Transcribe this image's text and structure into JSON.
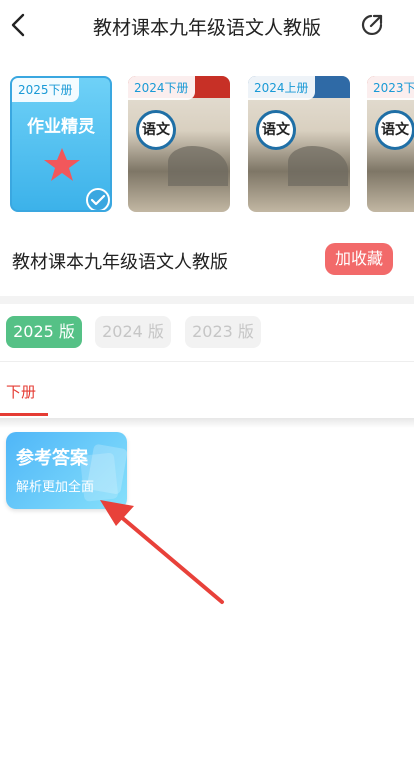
{
  "header": {
    "title": "教材课本九年级语文人教版",
    "back_icon": "chevron-left-icon",
    "share_icon": "share-icon"
  },
  "books": [
    {
      "tag": "2025下册",
      "cover_text": "作业精灵",
      "selected": true
    },
    {
      "tag": "2024下册",
      "cover_text": "语文"
    },
    {
      "tag": "2024上册",
      "cover_text": "语文"
    },
    {
      "tag": "2023下",
      "cover_text": "语文"
    }
  ],
  "book": {
    "name": "教材课本九年级语文人教版",
    "favorite_label": "加收藏"
  },
  "versions": [
    {
      "label": "2025 版",
      "active": true
    },
    {
      "label": "2024 版",
      "active": false
    },
    {
      "label": "2023 版",
      "active": false
    }
  ],
  "tabs": [
    {
      "label": "下册",
      "active": true
    }
  ],
  "answer_card": {
    "title": "参考答案",
    "subtitle": "解析更加全面"
  },
  "colors": {
    "accent_red": "#e53c34",
    "favorite_bg": "#f26a6a",
    "version_active": "#55c186",
    "card_blue": "#4fb6f8",
    "annotation_arrow": "#e8413a"
  }
}
